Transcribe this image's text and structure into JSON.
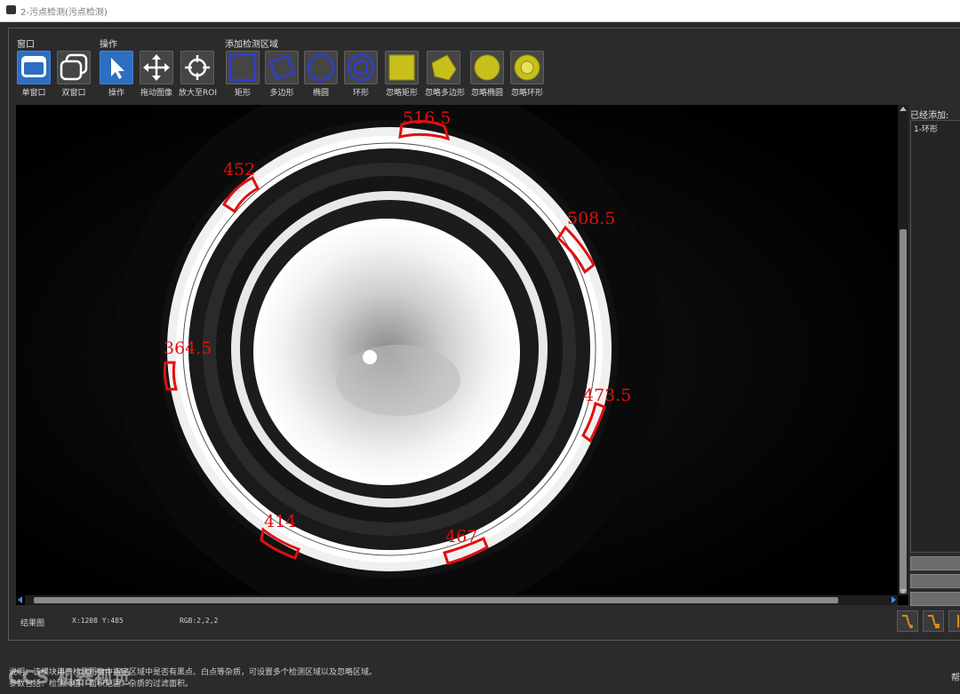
{
  "window": {
    "title": "2-污点检测(污点检测)"
  },
  "toolbar": {
    "groups": {
      "window": "窗口",
      "operation": "操作",
      "add_region": "添加检测区域"
    },
    "buttons": {
      "single_window": "单窗口",
      "dual_window": "双窗口",
      "operate": "操作",
      "drag_image": "拖动图像",
      "zoom_roi": "放大至ROI",
      "rectangle": "矩形",
      "polygon": "多边形",
      "ellipse": "椭圆",
      "ring": "环形",
      "ignore_rectangle": "忽略矩形",
      "ignore_polygon": "忽略多边形",
      "ignore_ellipse": "忽略椭圆",
      "ignore_ring": "忽略环形"
    }
  },
  "image": {
    "annotations": [
      {
        "label": "516.5"
      },
      {
        "label": "452"
      },
      {
        "label": "508.5"
      },
      {
        "label": "364.5"
      },
      {
        "label": "473.5"
      },
      {
        "label": "414"
      },
      {
        "label": "467"
      }
    ],
    "annotation_color": "#e01010"
  },
  "sidebar": {
    "added_label": "已经添加:",
    "items": [
      "1-环形"
    ]
  },
  "statusbar": {
    "view_name": "结果图",
    "coords": "X:1208 Y:485",
    "rgb": "RGB:2,2,2"
  },
  "help": {
    "line1": "说明：该模块用于检测图像中指定区域中是否有黑点、白点等杂质，可设置多个检测区域以及忽略区域。",
    "line2": "参数包括：检测阈值、面积范围、杂质的过滤面积。"
  },
  "watermark": "CCS 机器视觉",
  "right_edge_text": "帮"
}
